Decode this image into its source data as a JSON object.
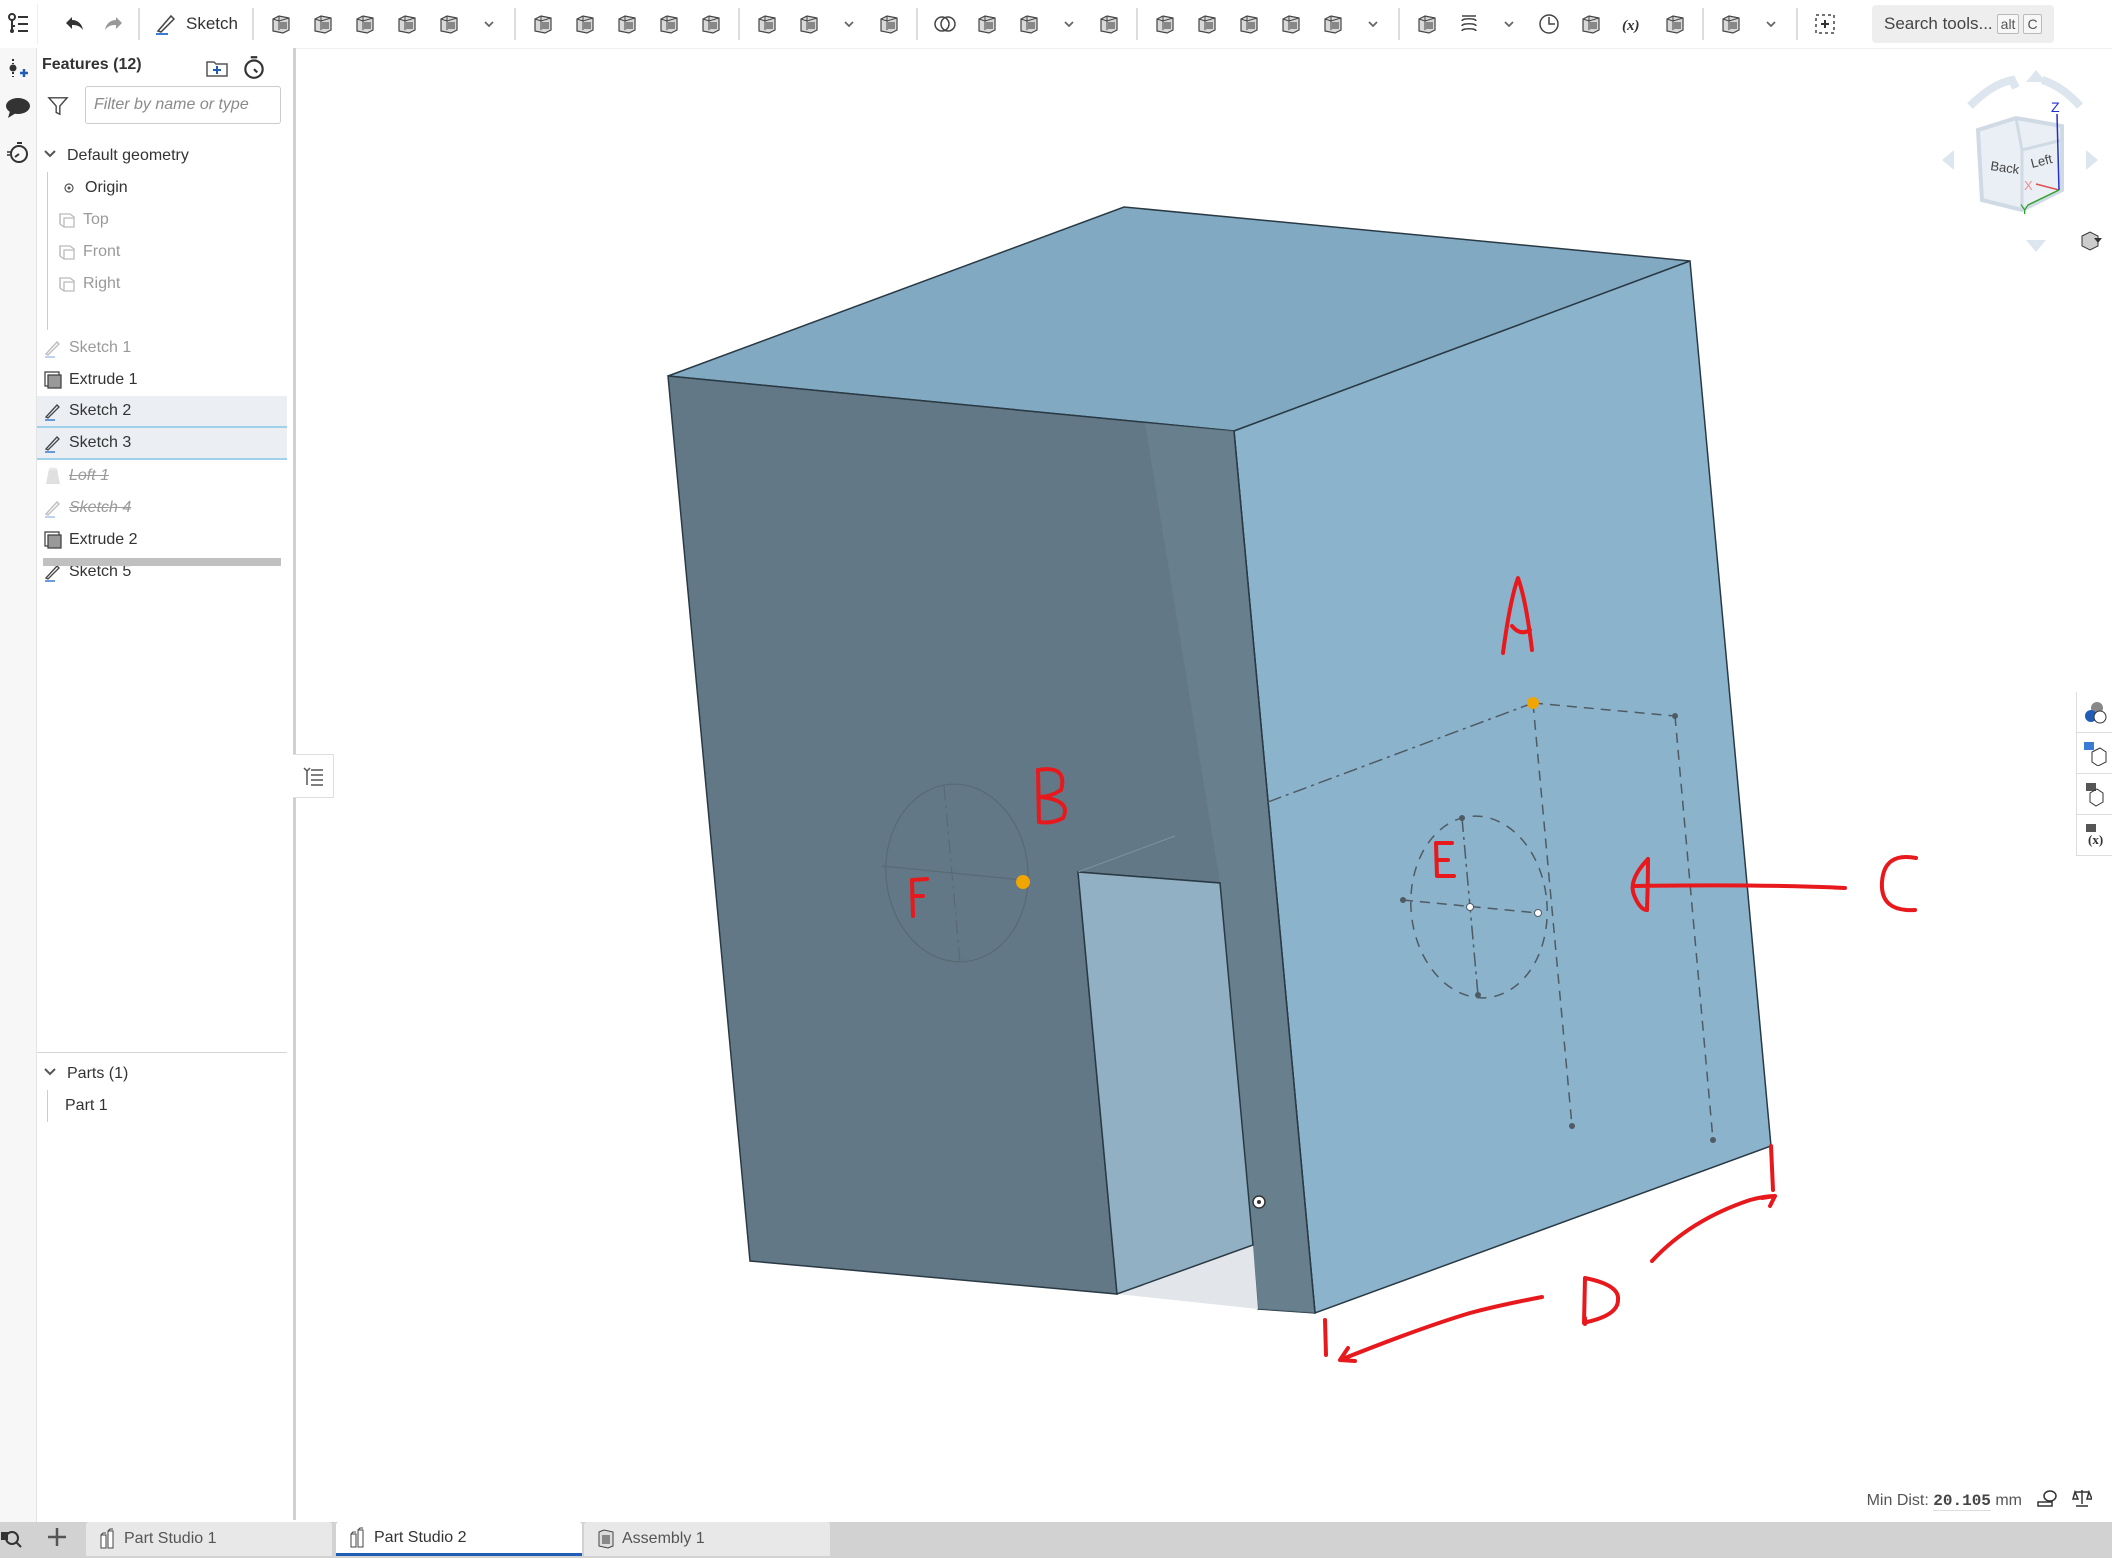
{
  "toolbar": {
    "sketch_label": "Sketch",
    "search_label": "Search tools...",
    "search_shortcut_1": "alt",
    "search_shortcut_2": "C",
    "icons": [
      "feature-list-icon",
      "undo-icon",
      "redo-icon",
      "sketch-icon",
      "extrude-icon",
      "revolve-icon",
      "sweep-icon",
      "loft-icon",
      "thicken-icon",
      "fillet-icon",
      "chamfer-icon",
      "draft-icon",
      "rib-icon",
      "shell-icon",
      "hole-icon",
      "pattern-icon",
      "mirror-icon",
      "boolean-icon",
      "split-icon",
      "transform-icon",
      "delete-part-icon",
      "modify-fillet-icon",
      "delete-face-icon",
      "move-face-icon",
      "replace-face-icon",
      "offset-surface-icon",
      "plane-icon",
      "helix-icon",
      "mate-connector-icon",
      "import-icon",
      "variable-icon",
      "derived-icon",
      "section-view-icon",
      "add-custom-feature-icon"
    ]
  },
  "features_panel": {
    "title": "Features (12)",
    "filter_placeholder": "Filter by name or type",
    "default_geometry_label": "Default geometry",
    "default_geometry": [
      {
        "label": "Origin",
        "icon": "origin-icon",
        "state": "normal"
      },
      {
        "label": "Top",
        "icon": "plane-icon",
        "state": "dim"
      },
      {
        "label": "Front",
        "icon": "plane-icon",
        "state": "dim"
      },
      {
        "label": "Right",
        "icon": "plane-icon",
        "state": "dim"
      }
    ],
    "features": [
      {
        "label": "Sketch 1",
        "icon": "sketch-icon",
        "state": "dim"
      },
      {
        "label": "Extrude 1",
        "icon": "extrude-icon",
        "state": "normal"
      },
      {
        "label": "Sketch 2",
        "icon": "sketch-icon",
        "state": "selected"
      },
      {
        "label": "Sketch 3",
        "icon": "sketch-icon",
        "state": "selected"
      },
      {
        "label": "Loft 1",
        "icon": "loft-icon",
        "state": "suppressed"
      },
      {
        "label": "Sketch 4",
        "icon": "sketch-icon",
        "state": "suppressed"
      },
      {
        "label": "Extrude 2",
        "icon": "extrude-icon",
        "state": "normal"
      },
      {
        "label": "Sketch 5",
        "icon": "sketch-icon",
        "state": "normal"
      }
    ],
    "parts_label": "Parts (1)",
    "parts": [
      {
        "label": "Part 1"
      }
    ]
  },
  "viewport": {
    "annotations": [
      "A",
      "B",
      "C",
      "D",
      "E",
      "F"
    ],
    "colors": {
      "face_light": "#8bb3cc",
      "face_top": "#81a9c2",
      "face_dark": "#627887",
      "notch": "#92b0c3",
      "annotation": "#e8191c",
      "highlight_point": "#f0a500"
    },
    "view_cube": {
      "faces": [
        "Back",
        "Left"
      ],
      "axes": [
        "X",
        "Y",
        "Z"
      ]
    }
  },
  "status": {
    "min_dist_label": "Min Dist:",
    "min_dist_value": "20.105",
    "min_dist_unit": "mm"
  },
  "tabs": [
    {
      "label": "Part Studio 1",
      "icon": "part-studio-icon",
      "active": false
    },
    {
      "label": "Part Studio 2",
      "icon": "part-studio-icon",
      "active": true
    },
    {
      "label": "Assembly 1",
      "icon": "assembly-icon",
      "active": false
    }
  ]
}
